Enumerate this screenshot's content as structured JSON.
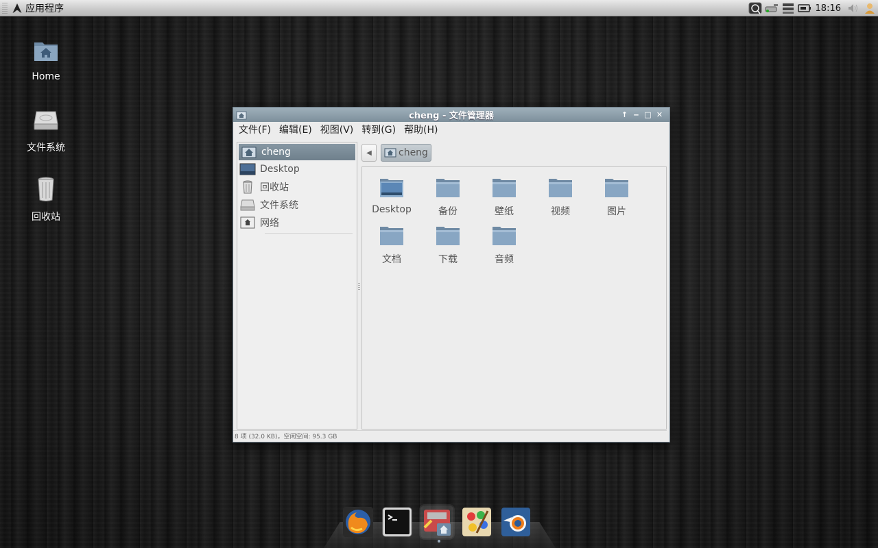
{
  "panel": {
    "app_menu_label": "应用程序",
    "clock": "18:16",
    "tray_icons": [
      "monitor-icon",
      "network-icon",
      "display-icon",
      "battery-icon",
      "volume-icon",
      "user-icon"
    ]
  },
  "desktop_icons": [
    {
      "label": "Home",
      "icon": "home-folder-icon"
    },
    {
      "label": "文件系统",
      "icon": "drive-icon"
    },
    {
      "label": "回收站",
      "icon": "trash-icon"
    }
  ],
  "window": {
    "title": "cheng - 文件管理器",
    "menu": [
      "文件(F)",
      "编辑(E)",
      "视图(V)",
      "转到(G)",
      "帮助(H)"
    ],
    "sidebar": [
      {
        "label": "cheng",
        "icon": "home-icon",
        "active": true
      },
      {
        "label": "Desktop",
        "icon": "desktop-icon"
      },
      {
        "label": "回收站",
        "icon": "trash-icon"
      },
      {
        "label": "文件系统",
        "icon": "drive-icon"
      },
      {
        "label": "网络",
        "icon": "network-icon"
      }
    ],
    "path": {
      "current": "cheng"
    },
    "files": [
      {
        "label": "Desktop",
        "icon": "desktop-folder-icon"
      },
      {
        "label": "备份",
        "icon": "folder-icon"
      },
      {
        "label": "壁纸",
        "icon": "folder-icon"
      },
      {
        "label": "视频",
        "icon": "folder-icon"
      },
      {
        "label": "图片",
        "icon": "folder-icon"
      },
      {
        "label": "文档",
        "icon": "folder-icon"
      },
      {
        "label": "下载",
        "icon": "folder-icon"
      },
      {
        "label": "音频",
        "icon": "folder-icon"
      }
    ],
    "status": "8 项 (32.0 KB)，空闲空间: 95.3 GB"
  },
  "dock": [
    {
      "name": "firefox",
      "icon": "firefox-icon"
    },
    {
      "name": "terminal",
      "icon": "terminal-icon"
    },
    {
      "name": "file-manager",
      "icon": "file-manager-icon",
      "running": true
    },
    {
      "name": "paint",
      "icon": "paint-icon"
    },
    {
      "name": "blender",
      "icon": "blender-icon"
    }
  ],
  "colors": {
    "panel": "#d0d0d0",
    "titlebar": "#8a9ba7",
    "folder": "#7f9ab3",
    "selection": "#7b8c98"
  }
}
